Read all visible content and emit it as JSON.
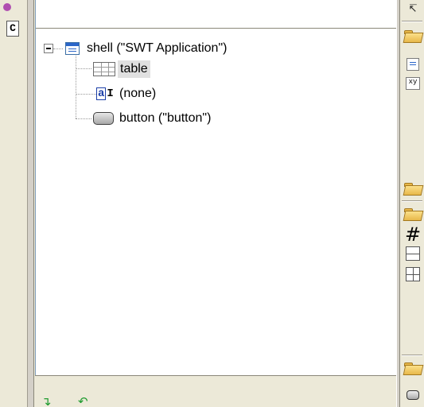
{
  "left_strip": {
    "c_label": "C"
  },
  "tree": {
    "root": {
      "label": "shell (\"SWT Application\")",
      "expanded": true
    },
    "children": [
      {
        "label": "table",
        "selected": true,
        "icon": "table-icon"
      },
      {
        "label": "(none)",
        "selected": false,
        "icon": "label-icon"
      },
      {
        "label": "button (\"button\")",
        "selected": false,
        "icon": "button-icon"
      }
    ]
  },
  "icons": {
    "label_glyph_a": "a",
    "label_glyph_bar": "I",
    "xy_glyph": "xy",
    "grid_glyph": "#",
    "cursor_glyph": "↸",
    "expand_down_glyph": "↴",
    "move_up_glyph": "↶"
  },
  "colors": {
    "selection_bg": "#e0e0e0",
    "panel_bg": "#ece9d8",
    "accent_green": "#1f9b2f"
  }
}
